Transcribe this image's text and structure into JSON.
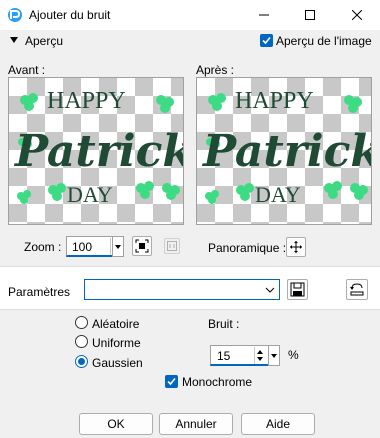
{
  "window": {
    "title": "Ajouter du bruit",
    "icon": "paintshop-app-icon"
  },
  "preview_section": {
    "toggle_label": "Aperçu",
    "show_on_image_label": "Aperçu de l'image",
    "show_on_image_checked": true
  },
  "previews": {
    "before_label": "Avant :",
    "after_label": "Après :",
    "image_text": {
      "line1": "HAPPY",
      "line2": "Patrick",
      "line3": "DAY"
    }
  },
  "zoom": {
    "label": "Zoom :",
    "value": "100",
    "pan_label": "Panoramique :"
  },
  "parameters": {
    "label": "Paramètres",
    "preset_value": ""
  },
  "noise_type": {
    "options": [
      {
        "label": "Aléatoire",
        "selected": false
      },
      {
        "label": "Uniforme",
        "selected": false
      },
      {
        "label": "Gaussien",
        "selected": true
      }
    ]
  },
  "noise": {
    "label": "Bruit :",
    "value": "15",
    "unit": "%",
    "monochrome_label": "Monochrome",
    "monochrome_checked": true
  },
  "buttons": {
    "ok": "OK",
    "cancel": "Annuler",
    "help": "Aide"
  },
  "colors": {
    "accent": "#0067c0",
    "ink": "#1f4a34",
    "shamrock": "#3ddc84"
  }
}
